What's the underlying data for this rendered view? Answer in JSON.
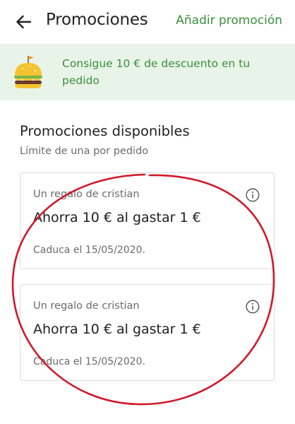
{
  "header": {
    "back_icon": "arrow-left-icon",
    "title": "Promociones",
    "action_label": "Añadir promoción"
  },
  "banner": {
    "icon": "burger-flag-icon",
    "text": "Consigue 10 € de descuento en tu pedido"
  },
  "section": {
    "title": "Promociones disponibles",
    "subtitle": "Límite de una por pedido"
  },
  "promotions": [
    {
      "from": "Un regalo de cristian",
      "title": "Ahorra 10 € al gastar 1 €",
      "expiry": "Caduca el 15/05/2020."
    },
    {
      "from": "Un regalo de cristian",
      "title": "Ahorra 10 € al gastar 1 €",
      "expiry": "Caduca el 15/05/2020."
    }
  ],
  "colors": {
    "accent_green": "#3a8f3a",
    "banner_background": "#e9f4e9",
    "annotation_red": "#d0192a"
  }
}
